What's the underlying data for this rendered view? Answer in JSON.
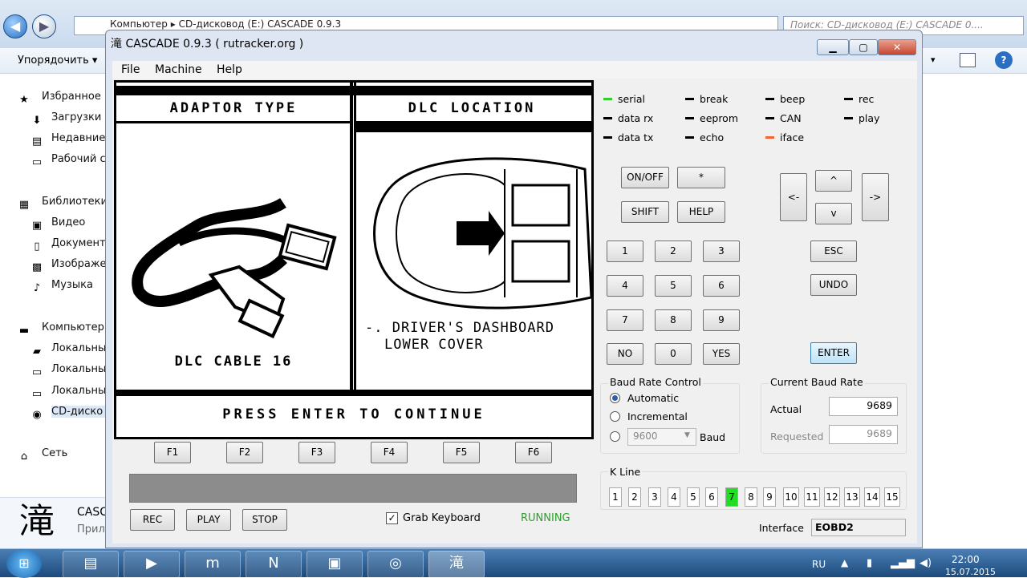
{
  "explorer": {
    "address": "Компьютер  ▸  CD-дисковод (E:) CASCADE 0.9.3",
    "search_placeholder": "Поиск: CD-дисковод (E:) CASCADE 0....",
    "organize": "Упорядочить ▾",
    "sidebar": [
      {
        "label": "Избранное",
        "icon": "★"
      },
      {
        "label": "Загрузки",
        "icon": "⬇"
      },
      {
        "label": "Недавние",
        "icon": "▤"
      },
      {
        "label": "Рабочий с",
        "icon": "▭"
      },
      {
        "label": "Библиотеки",
        "icon": "▦"
      },
      {
        "label": "Видео",
        "icon": "▣"
      },
      {
        "label": "Документ",
        "icon": "▯"
      },
      {
        "label": "Изображе",
        "icon": "▩"
      },
      {
        "label": "Музыка",
        "icon": "♪"
      },
      {
        "label": "Компьютер",
        "icon": "▬"
      },
      {
        "label": "Локальны",
        "icon": "▰"
      },
      {
        "label": "Локальны",
        "icon": "▭"
      },
      {
        "label": "Локальны",
        "icon": "▭"
      },
      {
        "label": "CD-диско",
        "icon": "◉"
      },
      {
        "label": "Сеть",
        "icon": "⌂"
      }
    ],
    "details_icon": "滝",
    "details_name": "CASCA",
    "details_type": "Прил"
  },
  "window": {
    "title": "CASCADE 0.9.3 ( rutracker.org )",
    "title_icon": "滝",
    "menu": [
      "File",
      "Machine",
      "Help"
    ]
  },
  "screen": {
    "left_header": "ADAPTOR TYPE",
    "right_header": "DLC LOCATION",
    "cable_label": "DLC CABLE 16",
    "location_line1": "-. DRIVER'S DASHBOARD",
    "location_line2": "LOWER COVER",
    "footer": "PRESS ENTER TO CONTINUE"
  },
  "fkeys": [
    "F1",
    "F2",
    "F3",
    "F4",
    "F5",
    "F6"
  ],
  "bottom_buttons": [
    "REC",
    "PLAY",
    "STOP"
  ],
  "grab_keyboard": {
    "label": "Grab Keyboard",
    "checked": true
  },
  "status": {
    "text": "RUNNING",
    "color": "#2aa02a"
  },
  "leds": [
    {
      "label": "serial",
      "color": "#33cc33"
    },
    {
      "label": "data rx",
      "color": "#000000"
    },
    {
      "label": "data tx",
      "color": "#000000"
    },
    {
      "label": "break",
      "color": "#000000"
    },
    {
      "label": "eeprom",
      "color": "#000000"
    },
    {
      "label": "echo",
      "color": "#000000"
    },
    {
      "label": "beep",
      "color": "#000000"
    },
    {
      "label": "CAN",
      "color": "#000000"
    },
    {
      "label": "iface",
      "color": "#ee6633"
    },
    {
      "label": "rec",
      "color": "#000000"
    },
    {
      "label": "play",
      "color": "#000000"
    }
  ],
  "keypad": {
    "onoff": "ON/OFF",
    "star": "*",
    "shift": "SHIFT",
    "help": "HELP",
    "digits": [
      "1",
      "2",
      "3",
      "4",
      "5",
      "6",
      "7",
      "8",
      "9"
    ],
    "no": "NO",
    "zero": "0",
    "yes": "YES",
    "left": "<-",
    "up": "^",
    "down": "v",
    "right": "->",
    "esc": "ESC",
    "undo": "UNDO",
    "enter": "ENTER"
  },
  "baud_control": {
    "title": "Baud Rate Control",
    "automatic": "Automatic",
    "incremental": "Incremental",
    "custom_value": "9600",
    "baud_label": "Baud"
  },
  "current_baud": {
    "title": "Current Baud Rate",
    "actual_label": "Actual",
    "actual_value": "9689",
    "requested_label": "Requested",
    "requested_value": "9689"
  },
  "kline": {
    "title": "K Line",
    "pins": [
      "1",
      "2",
      "3",
      "4",
      "5",
      "6",
      "7",
      "8",
      "9",
      "10",
      "11",
      "12",
      "13",
      "14",
      "15"
    ],
    "active": "7",
    "active_color": "#22dd22"
  },
  "interface": {
    "label": "Interface",
    "value": "EOBD2"
  },
  "taskbar": {
    "lang": "RU",
    "time": "22:00",
    "date": "15.07.2015"
  }
}
